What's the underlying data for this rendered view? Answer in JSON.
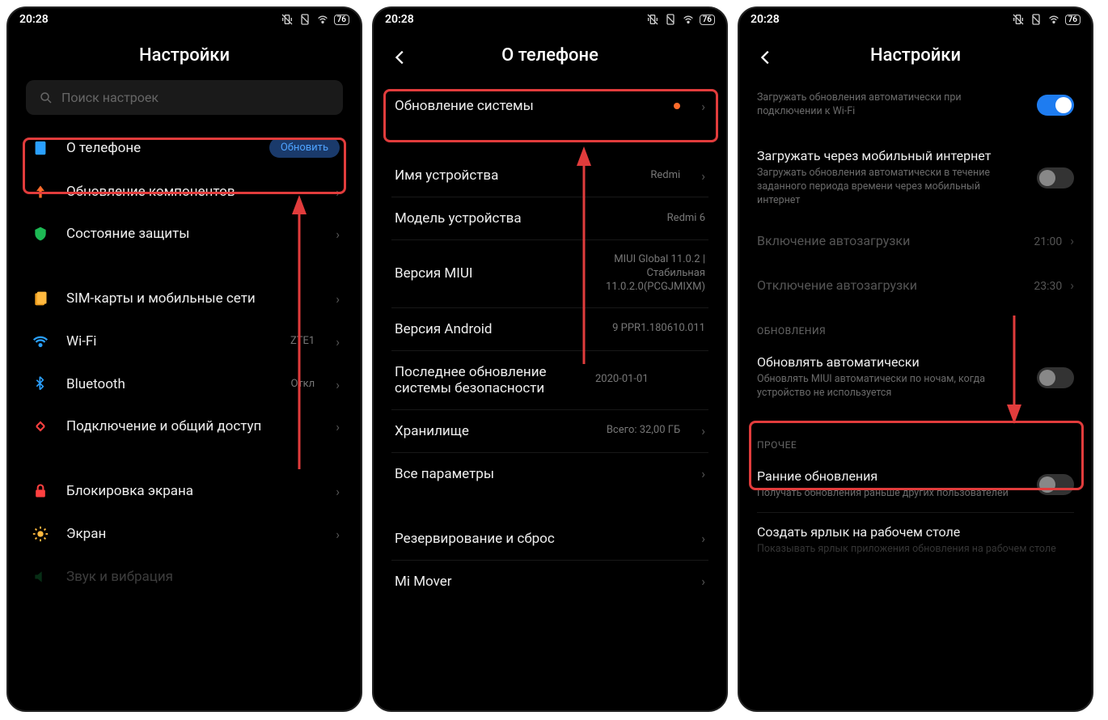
{
  "status": {
    "time": "20:28",
    "battery": "76"
  },
  "screen1": {
    "title": "Настройки",
    "search_placeholder": "Поиск настроек",
    "about_phone": {
      "label": "О телефоне",
      "update_btn": "Обновить"
    },
    "items1": [
      {
        "label": "Обновление компонентов"
      },
      {
        "label": "Состояние защиты"
      }
    ],
    "items2": [
      {
        "label": "SIM-карты и мобильные сети"
      },
      {
        "label": "Wi-Fi",
        "value": "ZTE1"
      },
      {
        "label": "Bluetooth",
        "value": "Откл"
      },
      {
        "label": "Подключение и общий доступ"
      }
    ],
    "items3": [
      {
        "label": "Блокировка экрана"
      },
      {
        "label": "Экран"
      },
      {
        "label": "Звук и вибрация"
      }
    ]
  },
  "screen2": {
    "title": "О телефоне",
    "system_update": "Обновление системы",
    "rows": [
      {
        "label": "Имя устройства",
        "value": "Redmi"
      },
      {
        "label": "Модель устройства",
        "value": "Redmi 6"
      },
      {
        "label": "Версия MIUI",
        "value": "MIUI Global 11.0.2 | Стабильная 11.0.2.0(PCGJMIXM)"
      },
      {
        "label": "Версия Android",
        "value": "9 PPR1.180610.011"
      },
      {
        "label": "Последнее обновление системы безопасности",
        "value": "2020-01-01"
      },
      {
        "label": "Хранилище",
        "value": "Всего: 32,00 ГБ"
      },
      {
        "label": "Все параметры",
        "value": ""
      }
    ],
    "rows2": [
      {
        "label": "Резервирование и сброс"
      },
      {
        "label": "Mi Mover"
      }
    ]
  },
  "screen3": {
    "title": "Настройки",
    "wifi_row": {
      "sub": "Загружать обновления автоматически при подключении к Wi-Fi"
    },
    "mobile_row": {
      "title": "Загружать через мобильный интернет",
      "sub": "Загружать обновления автоматически в течение заданного периода времени через мобильный интернет"
    },
    "autoload_on": {
      "label": "Включение автозагрузки",
      "value": "21:00"
    },
    "autoload_off": {
      "label": "Отключение автозагрузки",
      "value": "23:30"
    },
    "section_updates": "ОБНОВЛЕНИЯ",
    "auto_update": {
      "title": "Обновлять автоматически",
      "sub": "Обновлять MIUI автоматически по ночам, когда устройство не используется"
    },
    "section_other": "ПРОЧЕЕ",
    "early": {
      "title": "Ранние обновления",
      "sub": "Получать обновления раньше других пользователей"
    },
    "shortcut": {
      "title": "Создать ярлык на рабочем столе",
      "sub": "Показывать ярлык приложения обновления на рабочем столе"
    }
  }
}
